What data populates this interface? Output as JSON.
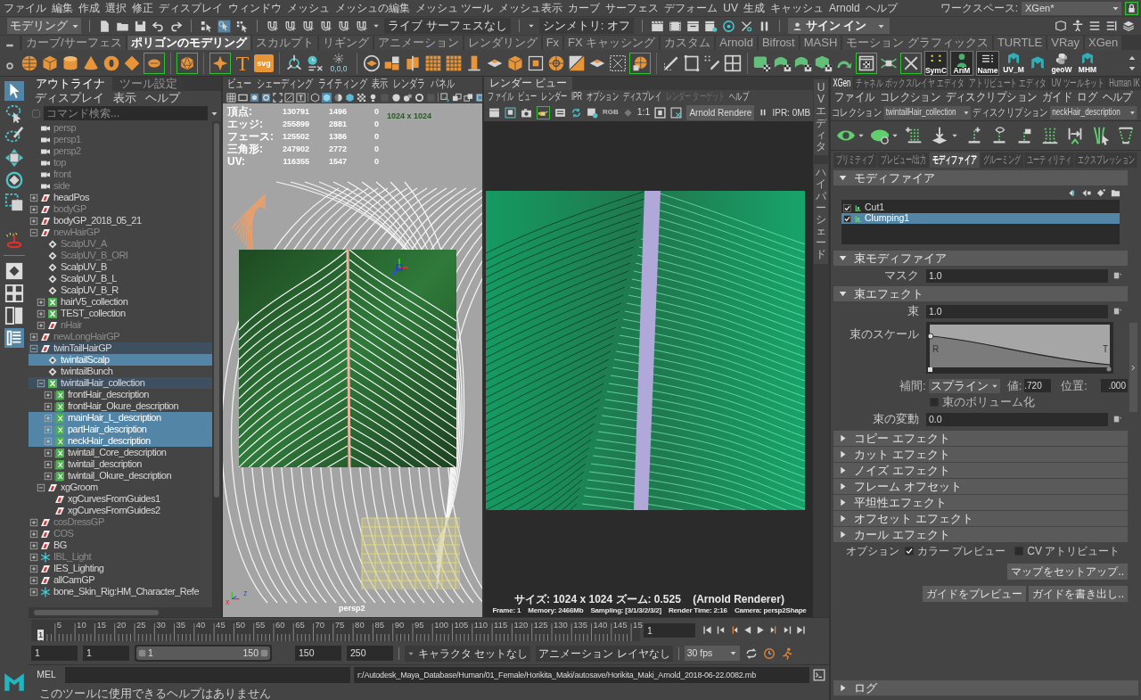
{
  "menubar": {
    "items": [
      "ファイル",
      "編集",
      "作成",
      "選択",
      "修正",
      "ディスプレイ",
      "ウィンドウ",
      "メッシュ",
      "メッシュの編集",
      "メッシュ ツール",
      "メッシュ表示",
      "カーブ",
      "サーフェス",
      "デフォーム",
      "UV",
      "生成",
      "キャッシュ",
      "Arnold",
      "ヘルプ"
    ],
    "workspace_label": "ワークスペース:",
    "workspace": "XGen*"
  },
  "status_line": {
    "mode": "モデリング",
    "live_surface": "ライブ サーフェスなし",
    "symmetry": "シンメトリ: オフ",
    "sign_in": "サイン イン"
  },
  "shelf": {
    "tabs": [
      {
        "label": "カーブ/サーフェス",
        "selected": false
      },
      {
        "label": "ポリゴンのモデリング",
        "selected": true
      },
      {
        "label": "スカルプト",
        "selected": false
      },
      {
        "label": "リギング",
        "selected": false
      },
      {
        "label": "アニメーション",
        "selected": false
      },
      {
        "label": "レンダリング",
        "selected": false
      },
      {
        "label": "Fx",
        "selected": false
      },
      {
        "label": "FX キャッシング",
        "selected": false
      },
      {
        "label": "カスタム",
        "selected": false
      },
      {
        "label": "Arnold",
        "selected": false
      },
      {
        "label": "Bifrost",
        "selected": false
      },
      {
        "label": "MASH",
        "selected": false
      },
      {
        "label": "モーション グラフィックス",
        "selected": false
      },
      {
        "label": "TURTLE",
        "selected": false
      },
      {
        "label": "VRay",
        "selected": false
      },
      {
        "label": "XGen",
        "selected": false
      }
    ],
    "type_tool": "T",
    "svg_tool": "svg",
    "origin_tool": "0,0,0",
    "custom_buttons": [
      {
        "label": "SymC",
        "kind": "dots"
      },
      {
        "label": "AriM",
        "kind": "figure"
      },
      {
        "label": "Name",
        "kind": "lines"
      },
      {
        "label": "UV_M",
        "kind": "logo"
      },
      {
        "label": "geoW",
        "kind": "snake"
      },
      {
        "label": "MHM",
        "kind": "logo"
      }
    ]
  },
  "outliner": {
    "tabs": [
      {
        "label": "アウトライナ",
        "selected": true
      },
      {
        "label": "ツール設定",
        "selected": false
      }
    ],
    "menus": [
      "ディスプレイ",
      "表示",
      "ヘルプ"
    ],
    "search": {
      "placeholder": "コマンド検索..."
    },
    "tree": [
      {
        "name": "persp",
        "kind": "camera",
        "expandable": false,
        "expanded": false,
        "dim": true,
        "selected": false,
        "highlighted": false
      },
      {
        "name": "persp1",
        "kind": "camera",
        "expandable": false,
        "expanded": false,
        "dim": true,
        "selected": false,
        "highlighted": false
      },
      {
        "name": "persp2",
        "kind": "camera",
        "expandable": false,
        "expanded": false,
        "dim": true,
        "selected": false,
        "highlighted": false
      },
      {
        "name": "top",
        "kind": "camera",
        "expandable": false,
        "expanded": false,
        "dim": true,
        "selected": false,
        "highlighted": false
      },
      {
        "name": "front",
        "kind": "camera",
        "expandable": false,
        "expanded": false,
        "dim": true,
        "selected": false,
        "highlighted": false
      },
      {
        "name": "side",
        "kind": "camera",
        "expandable": false,
        "expanded": false,
        "dim": true,
        "selected": false,
        "highlighted": false
      },
      {
        "name": "headPos",
        "kind": "group",
        "expandable": true,
        "expanded": false,
        "dim": false,
        "selected": false,
        "highlighted": false
      },
      {
        "name": "bodyGP",
        "kind": "group",
        "expandable": true,
        "expanded": false,
        "dim": true,
        "selected": false,
        "highlighted": false
      },
      {
        "name": "bodyGP_2018_05_21",
        "kind": "group",
        "expandable": true,
        "expanded": false,
        "dim": false,
        "selected": false,
        "highlighted": false
      },
      {
        "name": "newHairGP",
        "kind": "group",
        "expandable": true,
        "expanded": true,
        "dim": true,
        "selected": false,
        "highlighted": false,
        "children": [
          {
            "name": "ScalpUV_A",
            "kind": "mesh",
            "expandable": false,
            "expanded": false,
            "dim": true,
            "selected": false,
            "highlighted": false
          },
          {
            "name": "ScalpUV_B_ORI",
            "kind": "mesh",
            "expandable": false,
            "expanded": false,
            "dim": true,
            "selected": false,
            "highlighted": false
          },
          {
            "name": "ScalpUV_B",
            "kind": "mesh",
            "expandable": false,
            "expanded": false,
            "dim": false,
            "selected": false,
            "highlighted": false
          },
          {
            "name": "ScalpUV_B_L",
            "kind": "mesh",
            "expandable": false,
            "expanded": false,
            "dim": false,
            "selected": false,
            "highlighted": false
          },
          {
            "name": "ScalpUV_B_R",
            "kind": "mesh",
            "expandable": false,
            "expanded": false,
            "dim": false,
            "selected": false,
            "highlighted": false
          },
          {
            "name": "hairV5_collection",
            "kind": "collection",
            "expandable": true,
            "expanded": false,
            "dim": false,
            "selected": false,
            "highlighted": false
          },
          {
            "name": "TEST_collection",
            "kind": "collection",
            "expandable": true,
            "expanded": false,
            "dim": false,
            "selected": false,
            "highlighted": false
          },
          {
            "name": "nHair",
            "kind": "group",
            "expandable": true,
            "expanded": false,
            "dim": true,
            "selected": false,
            "highlighted": false
          }
        ]
      },
      {
        "name": "newLongHairGP",
        "kind": "group",
        "expandable": true,
        "expanded": false,
        "dim": true,
        "selected": false,
        "highlighted": false
      },
      {
        "name": "twinTailHairGP",
        "kind": "group",
        "expandable": true,
        "expanded": true,
        "dim": false,
        "selected": false,
        "highlighted": true,
        "children": [
          {
            "name": "twintailScalp",
            "kind": "mesh",
            "expandable": false,
            "expanded": false,
            "dim": false,
            "selected": true,
            "highlighted": false
          },
          {
            "name": "twintailBunch",
            "kind": "mesh",
            "expandable": false,
            "expanded": false,
            "dim": false,
            "selected": false,
            "highlighted": false
          },
          {
            "name": "twintailHair_collection",
            "kind": "collection",
            "expandable": true,
            "expanded": true,
            "dim": false,
            "selected": false,
            "highlighted": true,
            "children": [
              {
                "name": "frontHair_description",
                "kind": "description",
                "expandable": true,
                "expanded": false,
                "dim": false,
                "selected": false,
                "highlighted": false
              },
              {
                "name": "frontHair_Okure_description",
                "kind": "description",
                "expandable": true,
                "expanded": false,
                "dim": false,
                "selected": false,
                "highlighted": false
              },
              {
                "name": "mainHair_L_description",
                "kind": "description",
                "expandable": true,
                "expanded": false,
                "dim": false,
                "selected": true,
                "highlighted": false
              },
              {
                "name": "partHair_description",
                "kind": "description",
                "expandable": true,
                "expanded": false,
                "dim": false,
                "selected": true,
                "highlighted": false
              },
              {
                "name": "neckHair_description",
                "kind": "description",
                "expandable": true,
                "expanded": false,
                "dim": false,
                "selected": true,
                "highlighted": false
              },
              {
                "name": "twintail_Core_description",
                "kind": "description",
                "expandable": true,
                "expanded": false,
                "dim": false,
                "selected": false,
                "highlighted": false
              },
              {
                "name": "twintail_description",
                "kind": "description",
                "expandable": true,
                "expanded": false,
                "dim": false,
                "selected": false,
                "highlighted": false
              },
              {
                "name": "twintail_Okure_description",
                "kind": "description",
                "expandable": true,
                "expanded": false,
                "dim": false,
                "selected": false,
                "highlighted": false
              }
            ]
          },
          {
            "name": "xgGroom",
            "kind": "group",
            "expandable": true,
            "expanded": true,
            "dim": false,
            "selected": false,
            "highlighted": false,
            "children": [
              {
                "name": "xgCurvesFromGuides1",
                "kind": "group",
                "expandable": false,
                "expanded": false,
                "dim": false,
                "selected": false,
                "highlighted": false
              },
              {
                "name": "xgCurvesFromGuides2",
                "kind": "group",
                "expandable": false,
                "expanded": false,
                "dim": false,
                "selected": false,
                "highlighted": false
              }
            ]
          }
        ]
      },
      {
        "name": "cosDressGP",
        "kind": "group",
        "expandable": true,
        "expanded": false,
        "dim": true,
        "selected": false,
        "highlighted": false
      },
      {
        "name": "COS",
        "kind": "group",
        "expandable": true,
        "expanded": false,
        "dim": true,
        "selected": false,
        "highlighted": false
      },
      {
        "name": "BG",
        "kind": "group",
        "expandable": true,
        "expanded": false,
        "dim": false,
        "selected": false,
        "highlighted": false
      },
      {
        "name": "IBL_Light",
        "kind": "light",
        "expandable": true,
        "expanded": false,
        "dim": true,
        "selected": false,
        "highlighted": false
      },
      {
        "name": "IES_Lighting",
        "kind": "group",
        "expandable": true,
        "expanded": false,
        "dim": false,
        "selected": false,
        "highlighted": false
      },
      {
        "name": "allCamGP",
        "kind": "group",
        "expandable": true,
        "expanded": false,
        "dim": false,
        "selected": false,
        "highlighted": false
      },
      {
        "name": "bone_Skin_Rig:HM_Character_Refe",
        "kind": "light",
        "expandable": true,
        "expanded": false,
        "dim": false,
        "selected": false,
        "highlighted": false
      }
    ]
  },
  "viewport": {
    "menus": [
      "ビュー",
      "シェーディング",
      "ライティング",
      "表示",
      "レンダラ",
      "パネル"
    ],
    "stats": [
      {
        "label": "頂点:",
        "values": [
          "130791",
          "1496",
          "0"
        ]
      },
      {
        "label": "エッジ:",
        "values": [
          "255899",
          "2881",
          "0"
        ]
      },
      {
        "label": "フェース:",
        "values": [
          "125502",
          "1386",
          "0"
        ]
      },
      {
        "label": "三角形:",
        "values": [
          "247902",
          "2772",
          "0"
        ]
      },
      {
        "label": "UV:",
        "values": [
          "116355",
          "1547",
          "0"
        ]
      }
    ],
    "resolution": "1024 x 1024",
    "camera": "persp2",
    "axes": [
      "x",
      "z"
    ]
  },
  "render_view": {
    "title": "レンダー ビュー",
    "menus": [
      {
        "label": "ファイル",
        "disabled": false
      },
      {
        "label": "ビュー",
        "disabled": false
      },
      {
        "label": "レンダー",
        "disabled": false
      },
      {
        "label": "IPR",
        "disabled": false
      },
      {
        "label": "オプション",
        "disabled": false
      },
      {
        "label": "ディスプレイ",
        "disabled": false
      },
      {
        "label": "レンダー ターゲット",
        "disabled": true
      },
      {
        "label": "ヘルプ",
        "disabled": false
      }
    ],
    "channels": "RGB",
    "ratio": "1:1",
    "renderer": "Arnold Rendere",
    "ipr": "IPR: 0MB",
    "info": [
      "サイズ: 1024 x 1024 ズーム: 0.525    (Arnold Renderer)",
      "Frame: 1    Memory: 2466Mb    Sampling: [3/1/3/2/3/2]    Render Time: 2:16    Camera: persp2Shape"
    ]
  },
  "side_tabs": [
    "UV エディタ",
    "ハイパーシェード"
  ],
  "xgen": {
    "tabs": [
      {
        "label": "XGen",
        "selected": true
      },
      {
        "label": "チャネル ボックス/レイヤ エディタ",
        "selected": false
      },
      {
        "label": "アトリビュート エディタ",
        "selected": false
      },
      {
        "label": "UV ツールキット",
        "selected": false
      },
      {
        "label": "Human IK",
        "selected": false
      }
    ],
    "menus": [
      "ファイル",
      "コレクション",
      "ディスクリプション",
      "ガイド",
      "ログ",
      "ヘルプ"
    ],
    "collection": {
      "label": "コレクション",
      "value": "twintailHair_collection"
    },
    "description": {
      "label": "ディスクリプション",
      "value": "neckHair_description"
    },
    "subtabs": [
      {
        "label": "プリミティブ",
        "selected": false
      },
      {
        "label": "プレビュー/出力",
        "selected": false
      },
      {
        "label": "モディファイア",
        "selected": true
      },
      {
        "label": "グルーミング",
        "selected": false
      },
      {
        "label": "ユーティリティ",
        "selected": false
      },
      {
        "label": "エクスプレッション",
        "selected": false
      }
    ],
    "modifier_section": {
      "title": "モディファイア",
      "expanded": true,
      "modifiers": [
        {
          "name": "Cut1",
          "checked": true,
          "selected": false
        },
        {
          "name": "Clumping1",
          "checked": true,
          "selected": true
        }
      ]
    },
    "clump_section": {
      "title": "束モディファイア",
      "expanded": true,
      "mask": {
        "label": "マスク",
        "value": "1.0"
      }
    },
    "clump_effect": {
      "title": "束エフェクト",
      "expanded": true,
      "clump": {
        "label": "束",
        "value": "1.0"
      },
      "scale": {
        "label": "束のスケール",
        "root": "R",
        "tip": "T",
        "interpolation_label": "補間:",
        "interpolation": "スプライン",
        "value_label": "値:",
        "value": ".720",
        "position_label": "位置:",
        "position": ".000"
      },
      "volumize": {
        "label": "束のボリューム化",
        "checked": false
      },
      "variance": {
        "label": "束の変動",
        "value": "0.0"
      }
    },
    "collapsed_sections": [
      {
        "title": "コピー エフェクト",
        "expanded": false
      },
      {
        "title": "カット エフェクト",
        "expanded": false
      },
      {
        "title": "ノイズ エフェクト",
        "expanded": false
      },
      {
        "title": "フレーム オフセット",
        "expanded": false
      },
      {
        "title": "平坦性エフェクト",
        "expanded": false
      },
      {
        "title": "オフセット エフェクト",
        "expanded": false
      },
      {
        "title": "カール エフェクト",
        "expanded": false
      }
    ],
    "options": {
      "label": "オプション",
      "items": [
        {
          "label": "カラー プレビュー",
          "checked": true
        },
        {
          "label": "CV アトリビュート",
          "checked": false
        }
      ]
    },
    "setup_button": "マップをセットアップ..",
    "guide_buttons": [
      "ガイドをプレビュー",
      "ガイドを書き出し.."
    ],
    "log_section": {
      "title": "ログ",
      "expanded": false
    }
  },
  "time_slider": {
    "ticks": [
      "5",
      "10",
      "15",
      "20",
      "25",
      "30",
      "35",
      "40",
      "45",
      "50",
      "55",
      "60",
      "65",
      "70",
      "75",
      "80",
      "85",
      "90",
      "95",
      "100",
      "105",
      "110",
      "115",
      "120",
      "125",
      "130",
      "135",
      "140",
      "145",
      "15"
    ],
    "marker": "1",
    "level": 0,
    "current_frame": "1"
  },
  "range_slider": {
    "animation_start": "1",
    "playback_start": "1",
    "slider_start": "1",
    "slider_end": "150",
    "level": 1,
    "playback_end": "150",
    "animation_end": "250",
    "character_set": "キャラクタ セットなし",
    "anim_layer": "アニメーション レイヤなし",
    "fps": "30 fps"
  },
  "command_line": {
    "label": "MEL",
    "path": "r:/Autodesk_Maya_Database/Human/01_Female/Horikita_Maki/autosave/Horikita_Maki_Arnold_2018-06-22.0082.mb"
  },
  "help_line": "このツールに使用できるヘルプはありません"
}
